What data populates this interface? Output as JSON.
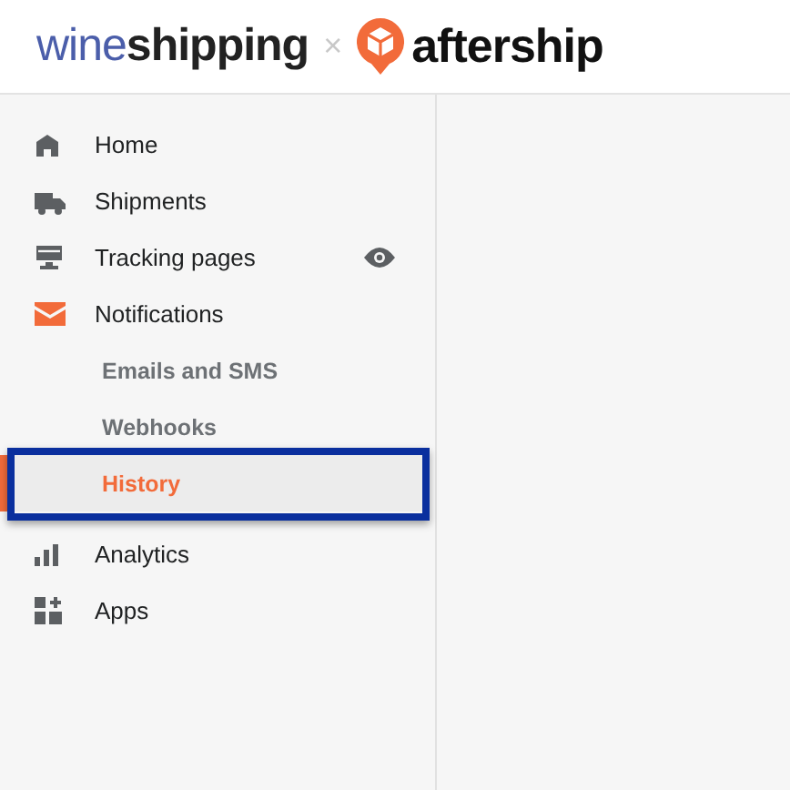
{
  "header": {
    "brand_part_1": "wine",
    "brand_part_2": "shipping",
    "separator": "×",
    "partner": "aftership"
  },
  "sidebar": {
    "items": [
      {
        "label": "Home",
        "selected": false,
        "preview": false
      },
      {
        "label": "Shipments",
        "selected": false,
        "preview": false
      },
      {
        "label": "Tracking pages",
        "selected": false,
        "preview": true
      },
      {
        "label": "Notifications",
        "selected": false,
        "preview": false,
        "children": [
          {
            "label": "Emails and SMS",
            "selected": false
          },
          {
            "label": "Webhooks",
            "selected": false
          },
          {
            "label": "History",
            "selected": true,
            "highlighted": true
          }
        ]
      },
      {
        "label": "Analytics",
        "selected": false,
        "preview": false
      },
      {
        "label": "Apps",
        "selected": false,
        "preview": false
      }
    ]
  }
}
